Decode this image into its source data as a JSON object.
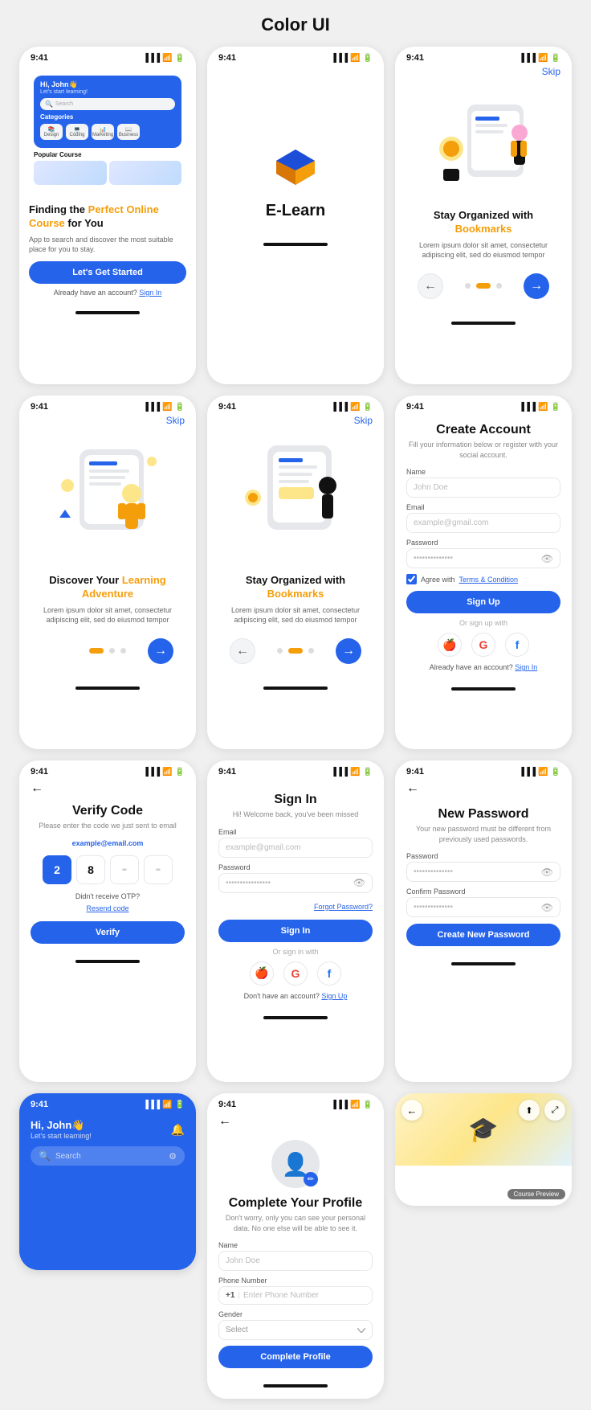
{
  "page": {
    "title": "Color UI"
  },
  "cards": {
    "home": {
      "status_time": "9:41",
      "greeting": "Hi, John👋",
      "sub": "Let's start learning!",
      "search_placeholder": "Search",
      "categories_label": "Categories",
      "popular_label": "Popular Course",
      "title": "Finding the ",
      "title_accent": "Perfect Online Course",
      "title_end": " for You",
      "subtitle": "App to search and discover the most suitable place for you to stay.",
      "btn_label": "Let's Get Started",
      "account_text": "Already have an account? ",
      "account_link": "Sign In"
    },
    "splash": {
      "status_time": "9:41",
      "logo_text": "E-Learn"
    },
    "onboard1": {
      "status_time": "9:41",
      "skip": "Skip",
      "title": "Stay Organized with ",
      "title_accent": "Bookmarks",
      "subtitle": "Lorem ipsum dolor sit amet, consectetur adipiscing elit, sed do eiusmod tempor"
    },
    "onboard2": {
      "status_time": "9:41",
      "skip": "Skip",
      "title": "Discover Your ",
      "title_accent": "Learning Adventure",
      "subtitle": "Lorem ipsum dolor sit amet, consectetur adipiscing elit, sed do eiusmod tempor"
    },
    "onboard3": {
      "status_time": "9:41",
      "skip": "Skip",
      "title": "Stay Organized with ",
      "title_accent": "Bookmarks",
      "subtitle": "Lorem ipsum dolor sit amet, consectetur adipiscing elit, sed do eiusmod tempor"
    },
    "create_account": {
      "status_time": "9:41",
      "title": "Create Account",
      "subtitle": "Fill your information below or register with your social account.",
      "name_label": "Name",
      "name_placeholder": "John Doe",
      "email_label": "Email",
      "email_placeholder": "example@gmail.com",
      "password_label": "Password",
      "password_placeholder": "••••••••••••••",
      "agree_text": "Agree with ",
      "agree_link": "Terms & Condition",
      "btn_label": "Sign Up",
      "or_text": "Or sign up with",
      "already_text": "Already have an account? ",
      "already_link": "Sign In"
    },
    "sign_in": {
      "status_time": "9:41",
      "title": "Sign In",
      "subtitle": "Hi! Welcome back, you've been missed",
      "email_label": "Email",
      "email_placeholder": "example@gmail.com",
      "password_label": "Password",
      "password_placeholder": "••••••••••••••••",
      "forgot": "Forgot Password?",
      "btn_label": "Sign In",
      "or_text": "Or sign in with",
      "no_account": "Don't have an account? ",
      "signup_link": "Sign Up"
    },
    "verify": {
      "status_time": "9:41",
      "title": "Verify Code",
      "subtitle": "Please enter the code we just sent to email",
      "email": "example@email.com",
      "code": [
        "2",
        "8",
        "-",
        "-"
      ],
      "resend_label": "Didn't receive OTP?",
      "resend_link": "Resend code",
      "btn_label": "Verify"
    },
    "new_password": {
      "status_time": "9:41",
      "title": "New Password",
      "subtitle": "Your new password must be different from previously used passwords.",
      "password_label": "Password",
      "password_placeholder": "••••••••••••••",
      "confirm_label": "Confirm Password",
      "confirm_placeholder": "••••••••••••••",
      "btn_label": "Create New Password"
    },
    "home_blue": {
      "status_time": "9:41",
      "greeting": "Hi, John👋",
      "subtitle": "Let's start learning!",
      "search_placeholder": "Search"
    },
    "complete_profile": {
      "status_time": "9:41",
      "title": "Complete Your Profile",
      "subtitle": "Don't worry, only you can see your personal data. No one else will be able to see it.",
      "name_label": "Name",
      "name_placeholder": "John Doe",
      "phone_label": "Phone Number",
      "phone_code": "+1",
      "phone_placeholder": "Enter Phone Number",
      "gender_label": "Gender",
      "gender_placeholder": "Select",
      "btn_label": "Complete Profile"
    },
    "course_preview": {
      "label": "Course Preview",
      "nav_share": "share",
      "nav_expand": "expand"
    }
  }
}
